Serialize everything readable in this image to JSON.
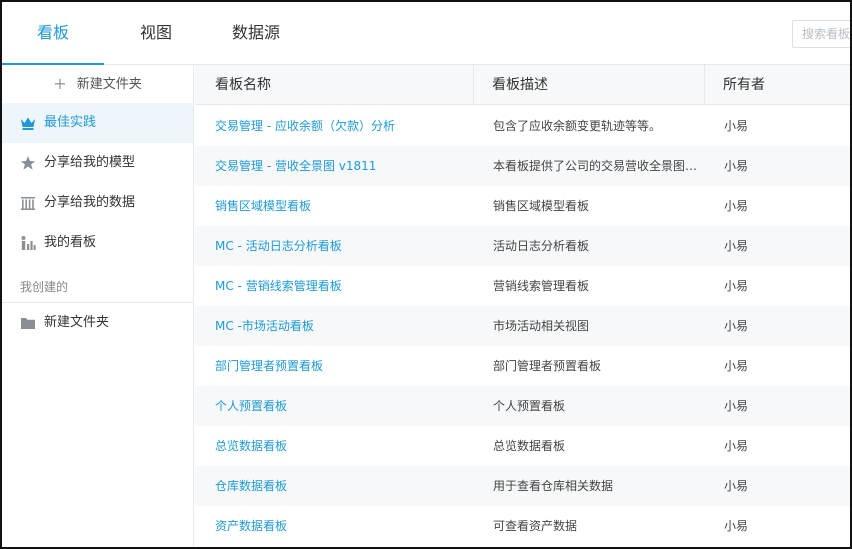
{
  "tabs": [
    {
      "label": "看板",
      "active": true
    },
    {
      "label": "视图",
      "active": false
    },
    {
      "label": "数据源",
      "active": false
    }
  ],
  "search": {
    "placeholder": "搜索看板"
  },
  "sidebar": {
    "new_folder_label": "新建文件夹",
    "items": [
      {
        "label": "最佳实践",
        "icon": "crown-icon",
        "active": true
      },
      {
        "label": "分享给我的模型",
        "icon": "star-icon",
        "active": false
      },
      {
        "label": "分享给我的数据",
        "icon": "data-icon",
        "active": false
      },
      {
        "label": "我的看板",
        "icon": "chart-icon",
        "active": false
      }
    ],
    "section_label": "我创建的",
    "folder_item": {
      "label": "新建文件夹",
      "icon": "folder-icon"
    }
  },
  "table": {
    "headers": [
      "看板名称",
      "看板描述",
      "所有者"
    ],
    "rows": [
      {
        "name": "交易管理 - 应收余额（欠款）分析",
        "description": "包含了应收余额变更轨迹等等。",
        "owner": "小易"
      },
      {
        "name": "交易管理 - 营收全景图 v1811",
        "description": "本看板提供了公司的交易营收全景图…",
        "owner": "小易"
      },
      {
        "name": "销售区域模型看板",
        "description": "销售区域模型看板",
        "owner": "小易"
      },
      {
        "name": "MC - 活动日志分析看板",
        "description": "活动日志分析看板",
        "owner": "小易"
      },
      {
        "name": "MC - 营销线索管理看板",
        "description": "营销线索管理看板",
        "owner": "小易"
      },
      {
        "name": "MC -市场活动看板",
        "description": "市场活动相关视图",
        "owner": "小易"
      },
      {
        "name": "部门管理者预置看板",
        "description": "部门管理者预置看板",
        "owner": "小易"
      },
      {
        "name": "个人预置看板",
        "description": "个人预置看板",
        "owner": "小易"
      },
      {
        "name": "总览数据看板",
        "description": "总览数据看板",
        "owner": "小易"
      },
      {
        "name": "仓库数据看板",
        "description": "用于查看仓库相关数据",
        "owner": "小易"
      },
      {
        "name": "资产数据看板",
        "description": "可查看资产数据",
        "owner": "小易"
      }
    ]
  },
  "colors": {
    "accent": "#1e9ad6",
    "row_alt": "#f7f8fa",
    "active_bg": "#eef5fb"
  }
}
